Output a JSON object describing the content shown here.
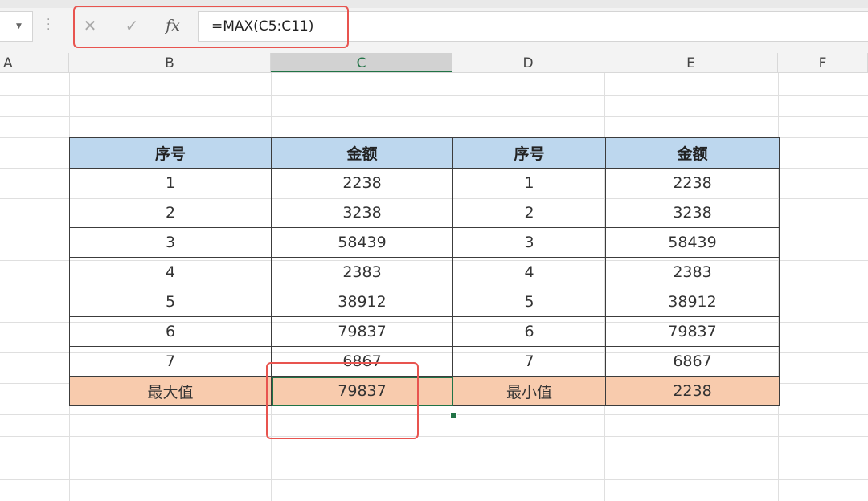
{
  "name_box": {
    "arrow_icon": "chevron-down-icon"
  },
  "formula_bar": {
    "cancel_icon": "✕",
    "enter_icon": "✓",
    "fx_label": "fx",
    "formula": "=MAX(C5:C11)",
    "highlight_color": "#e8544f"
  },
  "columns": [
    "A",
    "B",
    "C",
    "D",
    "E",
    "F"
  ],
  "selected_column": "C",
  "table": {
    "headers": [
      "序号",
      "金额",
      "序号",
      "金额"
    ],
    "rows": [
      [
        "1",
        "2238",
        "1",
        "2238"
      ],
      [
        "2",
        "3238",
        "2",
        "3238"
      ],
      [
        "3",
        "58439",
        "3",
        "58439"
      ],
      [
        "4",
        "2383",
        "4",
        "2383"
      ],
      [
        "5",
        "38912",
        "5",
        "38912"
      ],
      [
        "6",
        "79837",
        "6",
        "79837"
      ],
      [
        "7",
        "6867",
        "7",
        "6867"
      ]
    ],
    "result_row": [
      "最大值",
      "79837",
      "最小值",
      "2238"
    ],
    "header_color": "#bdd7ee",
    "result_color": "#f8cbad"
  },
  "accent_color": "#217346"
}
